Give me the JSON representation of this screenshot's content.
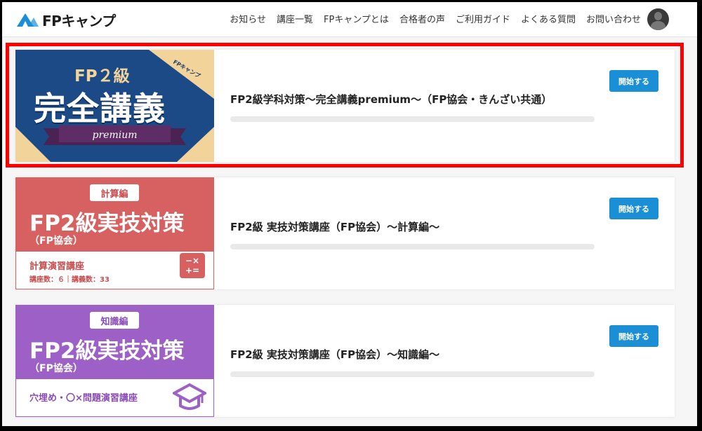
{
  "brand": {
    "name": "FPキャンプ",
    "accent": "#1a8fd6"
  },
  "nav": {
    "items": [
      "お知らせ",
      "講座一覧",
      "FPキャンプとは",
      "合格者の声",
      "ご利用ガイド",
      "よくある質問",
      "お問い合わせ"
    ]
  },
  "courses": [
    {
      "title": "FP2級学科対策～完全講義premium～（FP協会・きんざい共通）",
      "button": "開始する",
      "thumb": {
        "sub": "FP２級",
        "main": "完全講義",
        "ribbon": "premium",
        "logo": "FPキャンプ"
      }
    },
    {
      "title": "FP2級 実技対策講座（FP協会）～計算編～",
      "button": "開始する",
      "thumb": {
        "tag": "計算編",
        "main": "FP2級実技対策",
        "sub": "（FP協会）",
        "band_title": "計算演習講座",
        "band_meta": "講座数：６｜講義数：33",
        "icon_top": "−×",
        "icon_bottom": "+="
      }
    },
    {
      "title": "FP2級 実技対策講座（FP協会）～知識編～",
      "button": "開始する",
      "thumb": {
        "tag": "知識編",
        "main": "FP2級実技対策",
        "sub": "（FP協会）",
        "band_title": "穴埋め・〇×問題演習講座"
      }
    }
  ]
}
